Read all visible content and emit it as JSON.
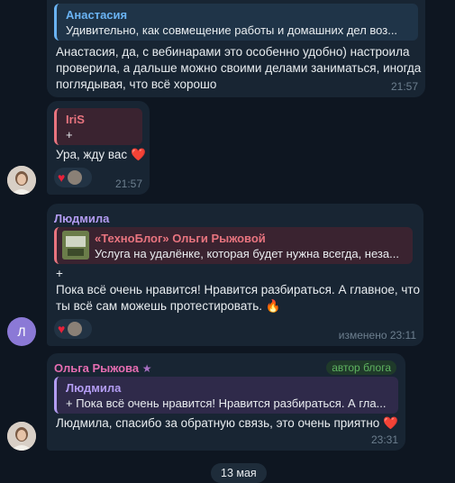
{
  "messages": {
    "m1": {
      "quote_name": "Анастасия",
      "quote_text": "Удивительно, как совмещение работы и домашних дел воз...",
      "line1": "Анастасия, да, с вебинарами это особенно удобно) настроила",
      "line2": "проверила, а дальше можно своими делами заниматься, иногда",
      "line3": "поглядывая, что всё хорошо",
      "time": "21:57"
    },
    "m2": {
      "quote_name": "IriS",
      "quote_text": "+",
      "text": "Ура, жду вас",
      "heart": "❤️",
      "time": "21:57"
    },
    "m3": {
      "sender": "Людмила",
      "avatar_letter": "Л",
      "quote_name": "«ТехноБлог» Ольги Рыжовой",
      "quote_text": "Услуга на удалёнке, которая будет нужна всегда, неза...",
      "line0": "+",
      "line1": "Пока всё очень нравится! Нравится разбираться. А главное, что",
      "line2": "ты всё сам можешь протестировать.",
      "fire": "🔥",
      "time": "изменено 23:11"
    },
    "m4": {
      "sender": "Ольга Рыжова",
      "star": "★",
      "badge": "автор блога",
      "quote_name": "Людмила",
      "quote_text": "+ Пока всё очень нравится! Нравится разбираться. А гла...",
      "text": "Людмила, спасибо за обратную связь, это очень приятно",
      "heart": "❤️",
      "time": "23:31"
    }
  },
  "date_chip": "13 мая",
  "colors": {
    "background": "#0e1621",
    "bubble": "#182533",
    "blue_name": "#6ab3f3",
    "red_name": "#e8747f",
    "purple_name": "#b39cf2",
    "pink_name": "#e56db1",
    "green_badge": "#5fb360",
    "avatar_purple": "#8b79d6"
  }
}
